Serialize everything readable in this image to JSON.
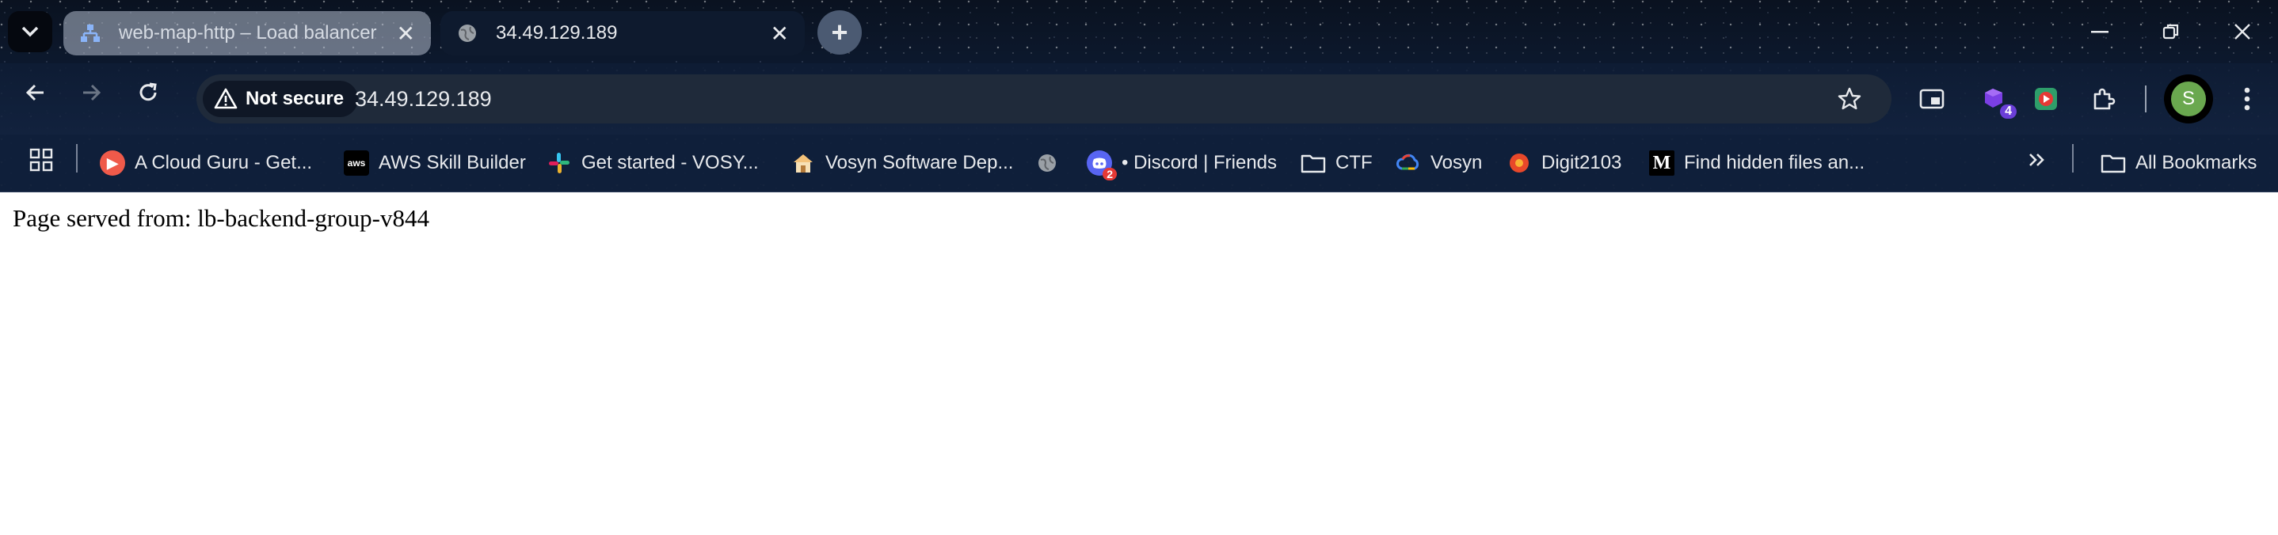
{
  "tabs": [
    {
      "title": "web-map-http – Load balancer",
      "favicon": "load-balancer-icon",
      "active": false
    },
    {
      "title": "34.49.129.189",
      "favicon": "globe-icon",
      "active": true
    }
  ],
  "new_tab_label": "+",
  "omnibox": {
    "security_label": "Not secure",
    "url": "34.49.129.189"
  },
  "extensions": {
    "badge_count": "4"
  },
  "profile": {
    "initial": "S",
    "color": "#6aa84f"
  },
  "bookmarks": [
    {
      "label": "A Cloud Guru - Get...",
      "icon": "acloudguru-icon",
      "color": "#ef5a4a"
    },
    {
      "label": "AWS Skill Builder",
      "icon": "aws-icon",
      "color": "#232f3e"
    },
    {
      "label": "Get started - VOSY...",
      "icon": "slack-icon",
      "color": "#e01e5a"
    },
    {
      "label": "Vosyn Software Dep...",
      "icon": "house-icon",
      "color": "#f4c27a"
    },
    {
      "label": "",
      "icon": "globe-icon",
      "color": "#9aa0a6"
    },
    {
      "label": "• Discord | Friends",
      "icon": "discord-icon",
      "color": "#5865f2",
      "badge": "2"
    },
    {
      "label": "CTF",
      "icon": "folder-icon",
      "color": "#e8eaed"
    },
    {
      "label": "Vosyn",
      "icon": "google-cloud-icon",
      "color": "#4285f4"
    },
    {
      "label": "Digit2103",
      "icon": "digit-icon",
      "color": "#e8482a"
    },
    {
      "label": "Find hidden files an...",
      "icon": "medium-icon",
      "color": "#000000"
    }
  ],
  "all_bookmarks_label": "All Bookmarks",
  "page": {
    "text": "Page served from: lb-backend-group-v844"
  }
}
